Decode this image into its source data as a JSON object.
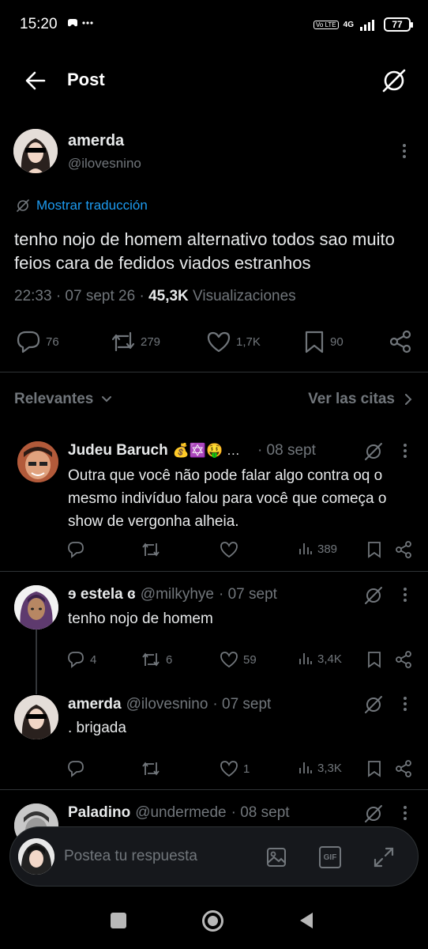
{
  "status_bar": {
    "time": "15:20",
    "extra_icons": "✉ …",
    "volte": "Vo LTE",
    "network": "4G",
    "battery": "77"
  },
  "header": {
    "title": "Post"
  },
  "post": {
    "name": "amerda",
    "handle": "@ilovesnino",
    "translate_label": "Mostrar traducción",
    "text": "tenho nojo de homem alternativo todos sao muito feios cara de fedidos viados estranhos",
    "timestamp": "22:33 · 07 sept 26 · ",
    "views_count": "45,3K",
    "views_label": " Visualizaciones",
    "stats": {
      "replies": "76",
      "reposts": "279",
      "likes": "1,7K",
      "bookmarks": "90"
    }
  },
  "sort": {
    "label": "Relevantes",
    "quotes_label": "Ver las citas"
  },
  "replies": [
    {
      "name": "Judeu Baruch",
      "emojis": "💰✡️🤑 …",
      "handle": "",
      "time": "· 08 sept",
      "text": "Outra que você não pode falar algo contra oq o mesmo indivíduo falou para você que começa o show de vergonha alheia.",
      "replies": "",
      "reposts": "",
      "likes": "",
      "views": "389"
    },
    {
      "name": "ɘ estela ɞ",
      "handle": "@milkyhye",
      "time": "· 07 sept",
      "text": "tenho nojo de homem",
      "replies": "4",
      "reposts": "6",
      "likes": "59",
      "views": "3,4K"
    },
    {
      "name": "amerda",
      "handle": "@ilovesnino",
      "time": "· 07 sept",
      "text": ". brigada",
      "replies": "",
      "reposts": "",
      "likes": "1",
      "views": "3,3K"
    },
    {
      "name": "Paladino",
      "handle": "@undermede",
      "time": "· 08 sept",
      "text": ""
    }
  ],
  "composer": {
    "placeholder": "Postea tu respuesta",
    "gif_label": "GIF"
  },
  "colors": {
    "background": "#000000",
    "accent": "#1d9bf0",
    "muted": "#71767b",
    "text": "#e7e9ea",
    "divider": "#2f3336"
  }
}
